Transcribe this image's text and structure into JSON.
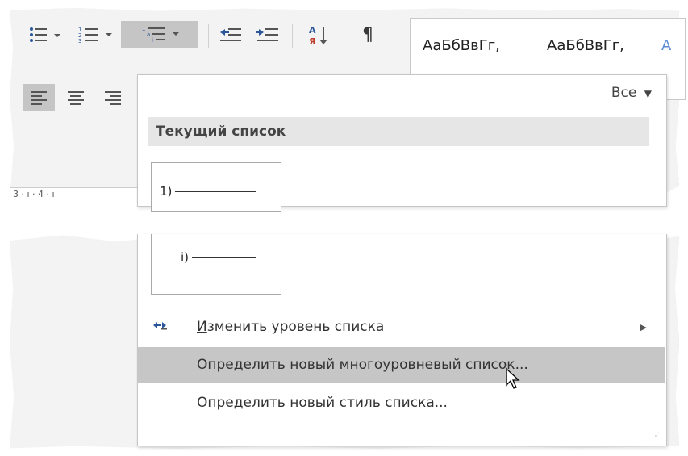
{
  "ribbon": {
    "styles_preview": [
      "АаБбВвГг,",
      "АаБбВвГг,",
      "А"
    ],
    "pilcrow": "¶",
    "ruler_text": "3 · ı · 4 · ı"
  },
  "menu": {
    "filter_label": "Все",
    "section_header": "Текущий список",
    "thumbnail_levels": [
      "1)",
      "i)"
    ],
    "items": [
      {
        "pre": "",
        "accel": "И",
        "post": "зменить уровень списка",
        "submenu": true,
        "highlighted": false
      },
      {
        "pre": "О",
        "accel": "п",
        "post": "ределить новый многоуровневый список...",
        "submenu": false,
        "highlighted": true
      },
      {
        "pre": "",
        "accel": "О",
        "post": "пределить новый стиль списка...",
        "submenu": false,
        "highlighted": false
      }
    ]
  },
  "colors": {
    "highlight": "#c6c6c6",
    "header_bg": "#e6e6e6",
    "accent": "#2b579a"
  }
}
